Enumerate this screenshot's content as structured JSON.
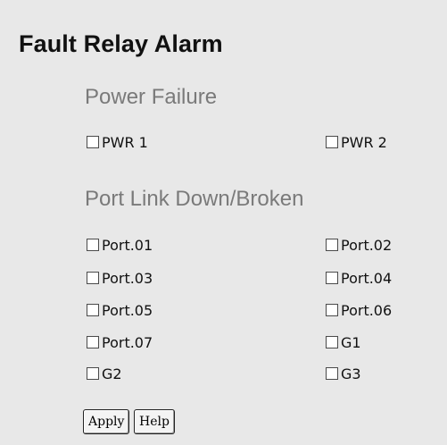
{
  "page": {
    "title": "Fault Relay Alarm"
  },
  "power_failure": {
    "title": "Power Failure",
    "items": [
      {
        "label": "PWR 1",
        "checked": false
      },
      {
        "label": "PWR 2",
        "checked": false
      }
    ]
  },
  "port_link": {
    "title": "Port Link Down/Broken",
    "items": [
      {
        "label": "Port.01",
        "checked": false
      },
      {
        "label": "Port.02",
        "checked": false
      },
      {
        "label": "Port.03",
        "checked": false
      },
      {
        "label": "Port.04",
        "checked": false
      },
      {
        "label": "Port.05",
        "checked": false
      },
      {
        "label": "Port.06",
        "checked": false
      },
      {
        "label": "Port.07",
        "checked": false
      },
      {
        "label": "G1",
        "checked": false
      },
      {
        "label": "G2",
        "checked": false
      },
      {
        "label": "G3",
        "checked": false
      }
    ]
  },
  "actions": {
    "apply_label": "Apply",
    "help_label": "Help"
  }
}
